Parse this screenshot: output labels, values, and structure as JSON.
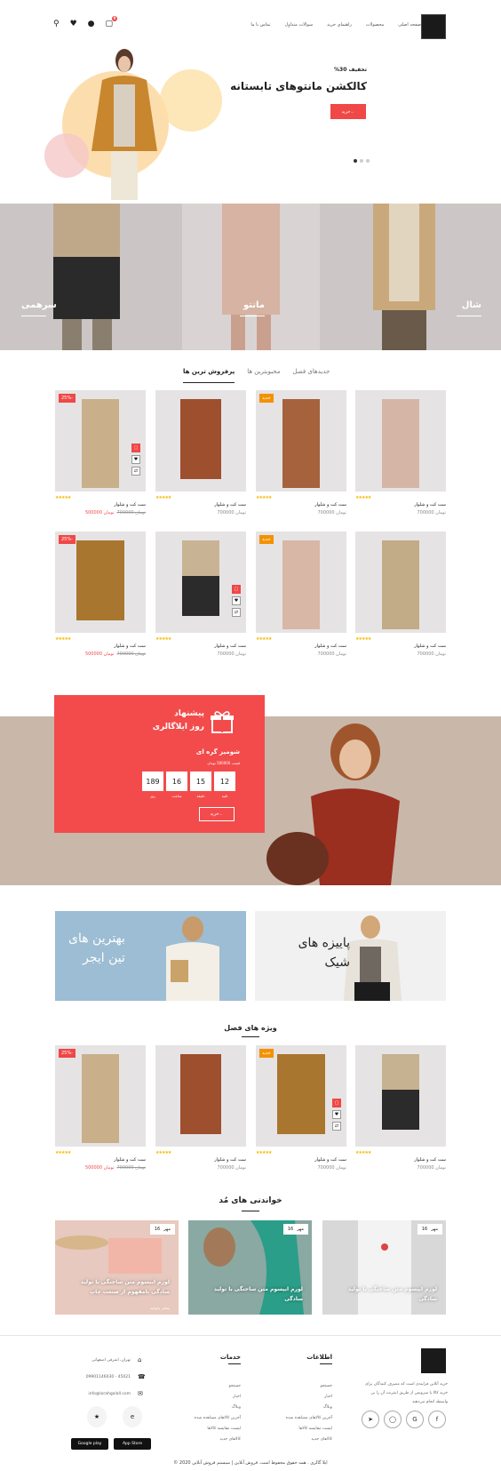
{
  "header": {
    "nav": [
      "صفحه اصلی",
      "محصولات",
      "راهنمای خرید",
      "سوالات متداول",
      "تماس با ما"
    ],
    "cart_count": "0"
  },
  "hero": {
    "subtitle": "تخفیف 30%",
    "title": "کالکشن مانتوهای تابستانه",
    "button": "خرید"
  },
  "categories": [
    {
      "label": "شال"
    },
    {
      "label": "مانتو"
    },
    {
      "label": "سرهمی"
    }
  ],
  "tabs": [
    "جدیدهای فصل",
    "محبوبترین ها",
    "پرفروش ترین ها"
  ],
  "products_row1": [
    {
      "name": "ست کت و شلوار",
      "price": "تومان 700000",
      "badge": ""
    },
    {
      "name": "ست کت و شلوار",
      "price": "تومان 700000",
      "badge": "جدید"
    },
    {
      "name": "ست کت و شلوار",
      "price": "تومان 700000",
      "badge": ""
    },
    {
      "name": "ست کت و شلوار",
      "price": "تومان 500000",
      "old": "تومان 700000",
      "badge": "-25%"
    }
  ],
  "products_row2": [
    {
      "name": "ست کت و شلوار",
      "price": "تومان 700000",
      "badge": ""
    },
    {
      "name": "ست کت و شلوار",
      "price": "تومان 700000",
      "badge": "جدید"
    },
    {
      "name": "ست کت و شلوار",
      "price": "تومان 700000",
      "badge": ""
    },
    {
      "name": "ست کت و شلوار",
      "price": "تومان 500000",
      "old": "تومان 700000",
      "badge": "-25%"
    }
  ],
  "offer": {
    "title_l1": "پیشنهاد",
    "title_l2": "روز ایلاگالری",
    "product": "شومیز گره ای",
    "price_line": "قیمت 500000 تومان",
    "button": "خرید",
    "countdown": [
      {
        "v": "12",
        "l": "ثانیه"
      },
      {
        "v": "15",
        "l": "دقیقه"
      },
      {
        "v": "16",
        "l": "ساعت"
      },
      {
        "v": "189",
        "l": "روز"
      }
    ]
  },
  "banners": {
    "left_l1": "بهترین های",
    "left_l2": "تین ایجر",
    "right_l1": "پاییزه های",
    "right_l2": "شیک"
  },
  "season": {
    "title": "ویژه های فصل",
    "products": [
      {
        "name": "ست کت و شلوار",
        "price": "تومان 700000",
        "badge": ""
      },
      {
        "name": "ست کت و شلوار",
        "price": "تومان 700000",
        "badge": "جدید"
      },
      {
        "name": "ست کت و شلوار",
        "price": "تومان 700000",
        "badge": ""
      },
      {
        "name": "ست کت و شلوار",
        "price": "تومان 500000",
        "old": "تومان 700000",
        "badge": "-25%"
      }
    ]
  },
  "blog": {
    "title": "خواندنی های مُد",
    "posts": [
      {
        "day": "16",
        "month": "مهر",
        "title": "لورم ایپسوم متن ساختگی با تولید سادگی"
      },
      {
        "day": "16",
        "month": "مهر",
        "title": "لورم ایپسوم متن ساختگی با تولید سادگی"
      },
      {
        "day": "16",
        "month": "مهر",
        "title": "لورم ایپسوم متن ساختگی با تولید سادگی نامفهوم از صنعت چاپ",
        "more": "بیشتر بخوانید"
      }
    ]
  },
  "footer": {
    "about": "خرید آنلاین فرایندی است که مصرف کنندگان برای خرید کالا یا سرویس از طریق اینترنت آن را بی‌ واسطه انجام می‌دهند",
    "info_title": "اطلاعات",
    "info_items": [
      "جستجو",
      "اخبار",
      "وبلاگ",
      "آخرین کالاهای مشاهده شده",
      "لیست مقایسه کالاها",
      "کالاهای جدید"
    ],
    "services_title": "خدمات",
    "services_items": [
      "جستجو",
      "اخبار",
      "وبلاگ",
      "آخرین کالاهای مشاهده شده",
      "لیست مقایسه کالاها",
      "کالاهای جدید"
    ],
    "address": "تهران، اشرفی اصفهانی",
    "phone": "09901146030 - 45021",
    "email": "info@lorahgalall.com",
    "google_play": "Google play",
    "app_store": "App Store",
    "copyright": "ایلا گالری . همه حقوق محفوظ است. فروش آنلاین | سیستم فروش آنلاین 2020 ©"
  }
}
